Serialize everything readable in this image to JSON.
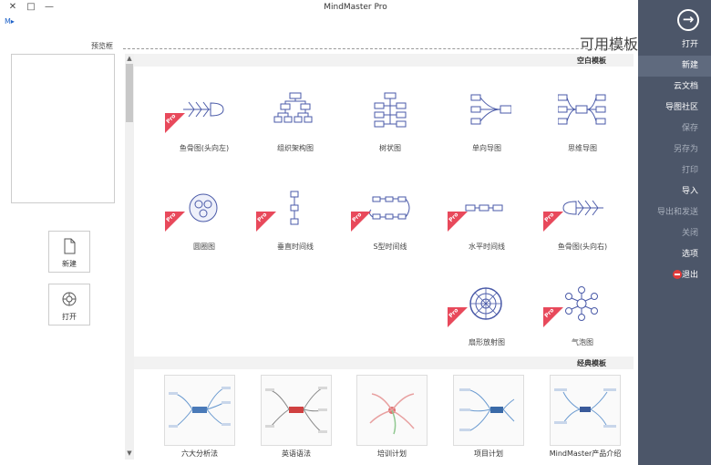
{
  "window": {
    "title": "MindMaster Pro",
    "controls": {
      "close": "✕",
      "maximize": "□",
      "minimize": "—"
    },
    "menu_button": "M▸"
  },
  "sidebar": {
    "back_label": "→",
    "items": [
      {
        "label": "打开",
        "state": "normal"
      },
      {
        "label": "新建",
        "state": "active"
      },
      {
        "label": "云文档",
        "state": "normal"
      },
      {
        "label": "导图社区",
        "state": "normal"
      },
      {
        "label": "保存",
        "state": "dim"
      },
      {
        "label": "另存为",
        "state": "dim"
      },
      {
        "label": "打印",
        "state": "dim"
      },
      {
        "label": "导入",
        "state": "normal"
      },
      {
        "label": "导出和发送",
        "state": "dim"
      },
      {
        "label": "关闭",
        "state": "dim"
      },
      {
        "label": "选项",
        "state": "normal"
      },
      {
        "label": "退出",
        "state": "normal"
      }
    ]
  },
  "main": {
    "heading": "可用模板",
    "preview_label": "预览框",
    "actions": {
      "new": "新建",
      "open": "打开"
    },
    "blank_section": "空白模板",
    "classic_section": "经典模板",
    "templates": [
      {
        "label": "思维导图",
        "icon": "mindmap-icon",
        "pro": false
      },
      {
        "label": "单向导图",
        "icon": "right-map-icon",
        "pro": false
      },
      {
        "label": "树状图",
        "icon": "tree-icon",
        "pro": false
      },
      {
        "label": "组织架构图",
        "icon": "org-chart-icon",
        "pro": false
      },
      {
        "label": "鱼骨图(头向左)",
        "icon": "fishbone-left-icon",
        "pro": true
      },
      {
        "label": "鱼骨图(头向右)",
        "icon": "fishbone-right-icon",
        "pro": true
      },
      {
        "label": "水平时间线",
        "icon": "h-timeline-icon",
        "pro": true
      },
      {
        "label": "S型时间线",
        "icon": "s-timeline-icon",
        "pro": true
      },
      {
        "label": "垂直时间线",
        "icon": "v-timeline-icon",
        "pro": true
      },
      {
        "label": "圆圈图",
        "icon": "circle-map-icon",
        "pro": true
      },
      {
        "label": "气泡图",
        "icon": "bubble-map-icon",
        "pro": true
      },
      {
        "label": "扇形放射图",
        "icon": "sector-radial-icon",
        "pro": true
      }
    ],
    "classic": [
      {
        "label": "MindMaster产品介绍"
      },
      {
        "label": "项目计划"
      },
      {
        "label": "培训计划"
      },
      {
        "label": "英语语法"
      },
      {
        "label": "六大分析法"
      }
    ]
  }
}
